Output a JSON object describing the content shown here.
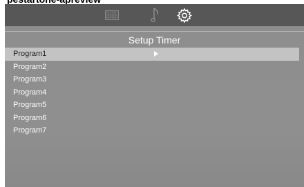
{
  "caption": "pestartone-apreview",
  "tabs": {
    "picture_icon": "grid-icon",
    "music_icon": "music-note-icon",
    "setup_icon": "gear-icon"
  },
  "title": "Setup Timer",
  "programs": [
    {
      "label": "Program1",
      "selected": true
    },
    {
      "label": "Program2",
      "selected": false
    },
    {
      "label": "Program3",
      "selected": false
    },
    {
      "label": "Program4",
      "selected": false
    },
    {
      "label": "Program5",
      "selected": false
    },
    {
      "label": "Program6",
      "selected": false
    },
    {
      "label": "Program7",
      "selected": false
    }
  ],
  "colors": {
    "topbar": "#575757",
    "panel": "#8f8f8f",
    "highlight": "#c3c3c3",
    "text": "#ffffff"
  }
}
